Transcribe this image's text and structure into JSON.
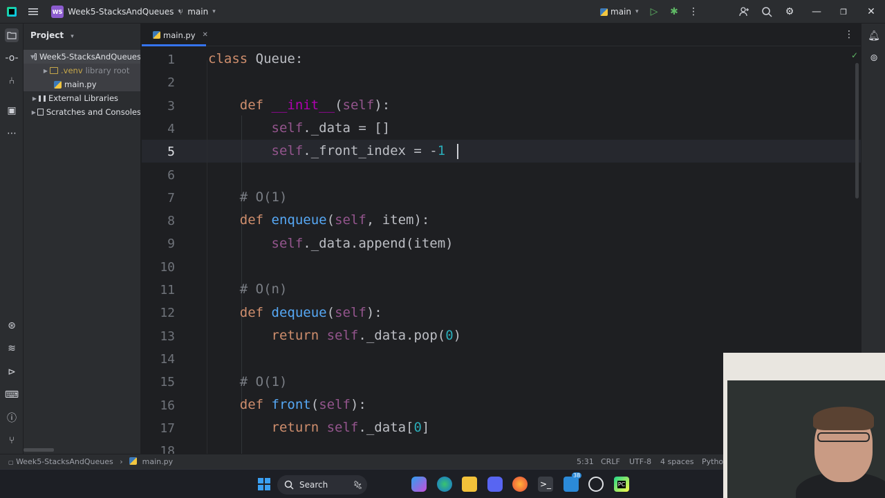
{
  "titlebar": {
    "project_badge": "WS",
    "project_name": "Week5-StacksAndQueues",
    "branch": "main",
    "run_config": "main"
  },
  "project_panel": {
    "header": "Project",
    "tree": [
      {
        "label": "Week5-StacksAndQueues",
        "type": "folder",
        "expanded": true
      },
      {
        "label": ".venv",
        "suffix": "library root",
        "type": "folder"
      },
      {
        "label": "main.py",
        "type": "python-file"
      },
      {
        "label": "External Libraries",
        "type": "library"
      },
      {
        "label": "Scratches and Consoles",
        "type": "scratches"
      }
    ]
  },
  "editor": {
    "tab_label": "main.py",
    "current_line": 5,
    "line_numbers": [
      "1",
      "2",
      "3",
      "4",
      "5",
      "6",
      "7",
      "8",
      "9",
      "10",
      "11",
      "12",
      "13",
      "14",
      "15",
      "16",
      "17",
      "18"
    ],
    "code": [
      "class Queue:",
      "",
      "    def __init__(self):",
      "        self._data = []",
      "        self._front_index = -1",
      "",
      "    # O(1)",
      "    def enqueue(self, item):",
      "        self._data.append(item)",
      "",
      "    # O(n)",
      "    def dequeue(self):",
      "        return self._data.pop(0)",
      "",
      "    # O(1)",
      "    def front(self):",
      "        return self._data[0]"
    ]
  },
  "statusbar": {
    "breadcrumb_project": "Week5-StacksAndQueues",
    "breadcrumb_file": "main.py",
    "position": "5:31",
    "line_ending": "CRLF",
    "encoding": "UTF-8",
    "indent": "4 spaces",
    "interpreter": "Pytho"
  },
  "taskbar": {
    "search_label": "Search",
    "badge_count": "38"
  },
  "colors": {
    "accent": "#3574f0",
    "background": "#1e1f22",
    "panel": "#2b2d30"
  }
}
